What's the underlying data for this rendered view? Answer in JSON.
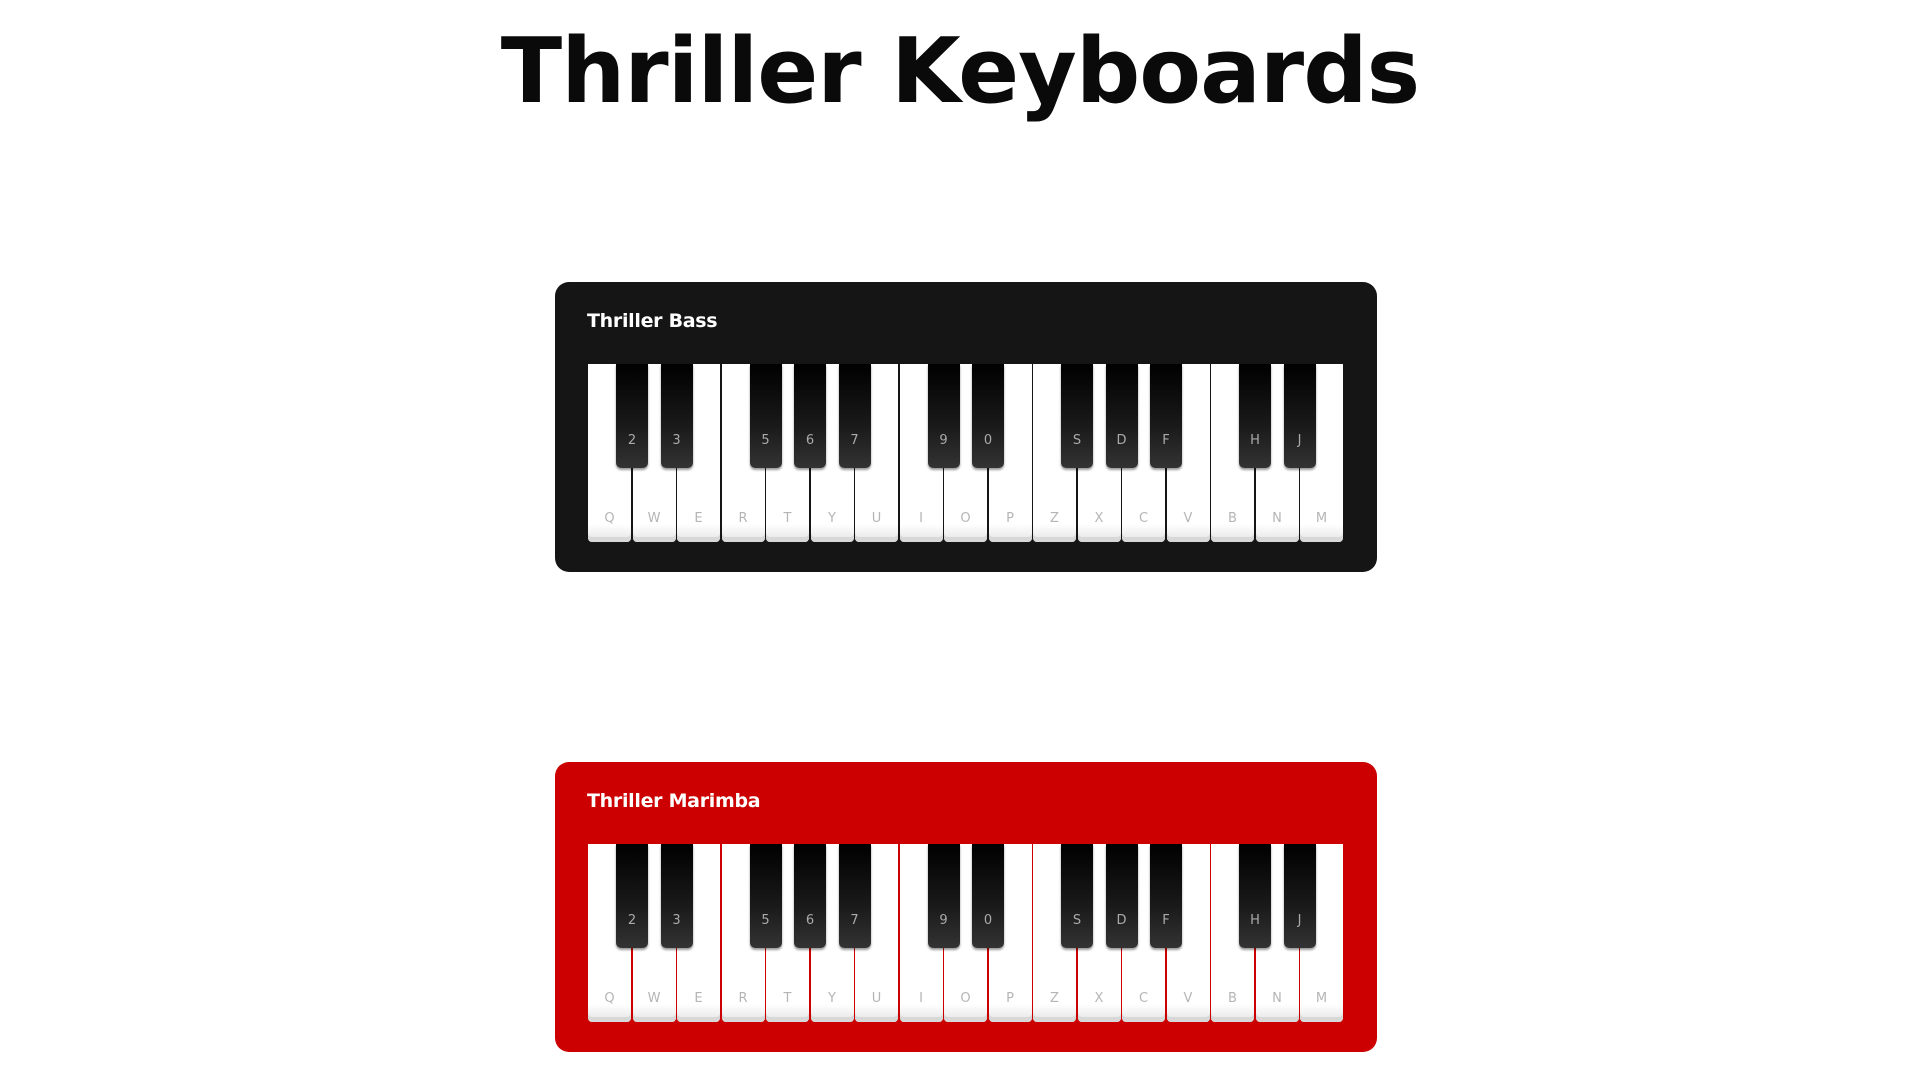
{
  "page": {
    "title": "Thriller Keyboards"
  },
  "keyboards": [
    {
      "name": "Thriller Bass",
      "color": "#151515",
      "white_keys": [
        "Q",
        "W",
        "E",
        "R",
        "T",
        "Y",
        "U",
        "I",
        "O",
        "P",
        "Z",
        "X",
        "C",
        "V",
        "B",
        "N",
        "M"
      ],
      "black_keys": [
        "2",
        "3",
        "5",
        "6",
        "7",
        "9",
        "0",
        "S",
        "D",
        "F",
        "H",
        "J"
      ]
    },
    {
      "name": "Thriller Marimba",
      "color": "#cc0000",
      "white_keys": [
        "Q",
        "W",
        "E",
        "R",
        "T",
        "Y",
        "U",
        "I",
        "O",
        "P",
        "Z",
        "X",
        "C",
        "V",
        "B",
        "N",
        "M"
      ],
      "black_keys": [
        "2",
        "3",
        "5",
        "6",
        "7",
        "9",
        "0",
        "S",
        "D",
        "F",
        "H",
        "J"
      ]
    }
  ]
}
